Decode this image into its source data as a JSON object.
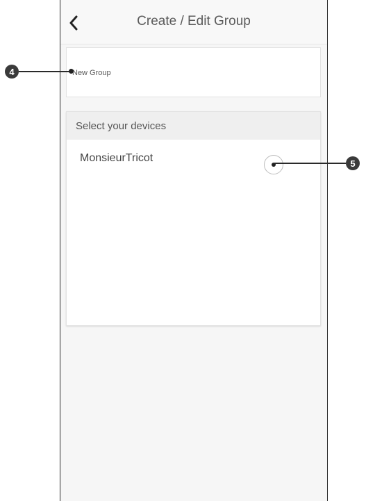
{
  "header": {
    "title": "Create / Edit Group",
    "back_icon": "chevron-left-icon"
  },
  "group_name": {
    "placeholder": "New Group",
    "value": ""
  },
  "devices": {
    "header_label": "Select your devices",
    "items": [
      {
        "name": "MonsieurTricot",
        "selected": false
      }
    ]
  },
  "callouts": [
    {
      "number": "4"
    },
    {
      "number": "5"
    }
  ]
}
